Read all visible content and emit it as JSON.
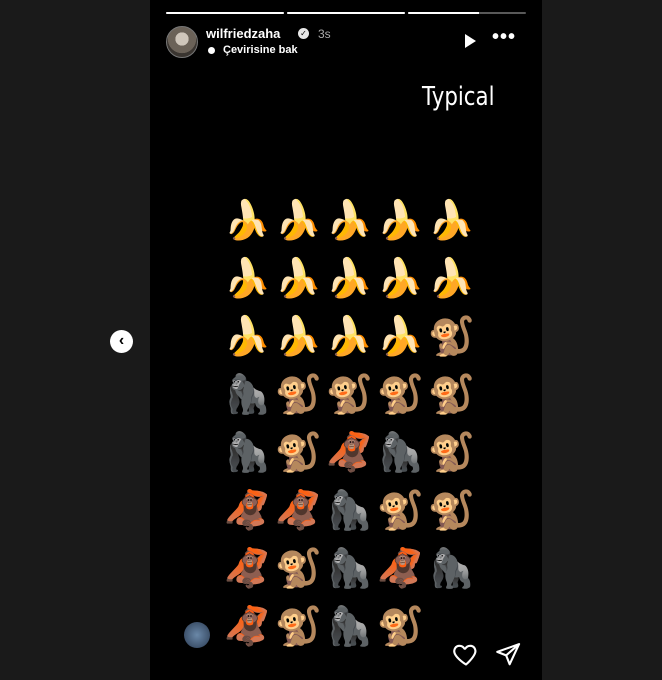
{
  "story": {
    "progress": [
      1,
      1,
      0.6
    ],
    "username": "wilfriedzaha",
    "time": "3s",
    "translate_label": "Çevirisine bak",
    "caption": "Typical",
    "play_icon": "play-icon",
    "more_icon": "more-icon",
    "emoji_rows": [
      [
        "🍌",
        "🍌",
        "🍌",
        "🍌",
        "🍌"
      ],
      [
        "🍌",
        "🍌",
        "🍌",
        "🍌",
        "🍌"
      ],
      [
        "🍌",
        "🍌",
        "🍌",
        "🍌",
        "🐒"
      ],
      [
        "🦍",
        "🐒",
        "🐒",
        "🐒",
        "🐒"
      ],
      [
        "🦍",
        "🐒",
        "🦧",
        "🦍",
        "🐒"
      ],
      [
        "🦧",
        "🦧",
        "🦍",
        "🐒",
        "🐒"
      ],
      [
        "🦧",
        "🐒",
        "🦍",
        "🦧",
        "🦍"
      ],
      [
        "🦧",
        "🐒",
        "🦍",
        "🐒",
        "🐵"
      ]
    ]
  },
  "navigation": {
    "prev_icon": "chevron-left-icon"
  },
  "footer": {
    "like_icon": "heart-icon",
    "share_icon": "send-icon"
  },
  "colors": {
    "story_bg": "#000000",
    "page_bg": "#1a1a1a",
    "text": "#ffffff"
  }
}
